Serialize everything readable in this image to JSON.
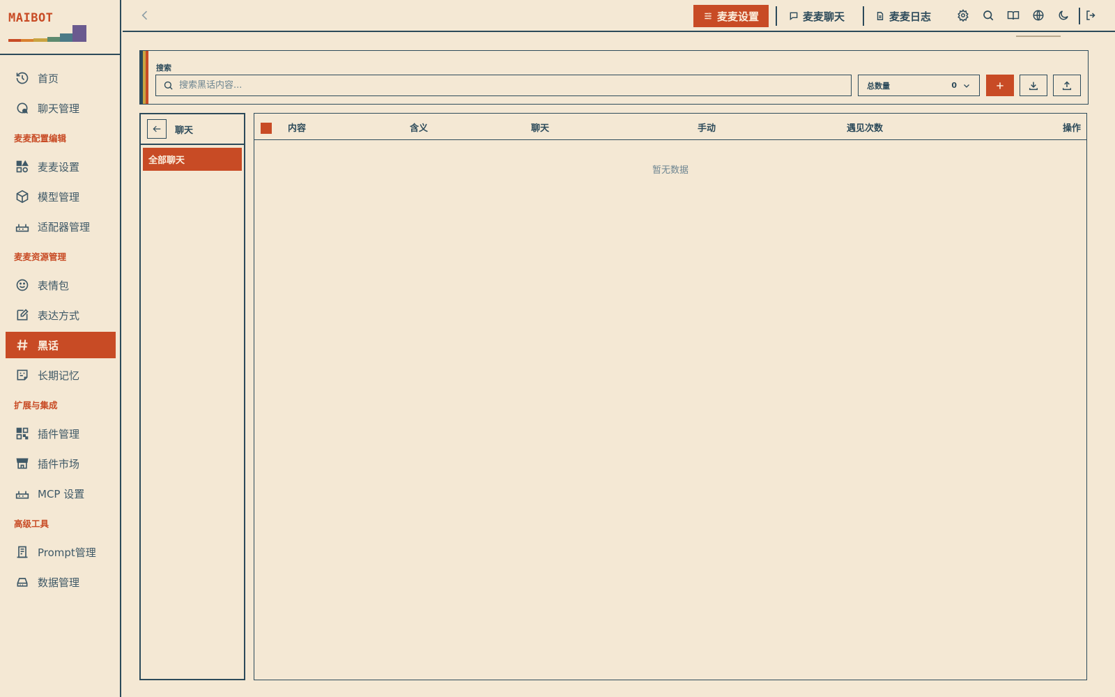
{
  "logo": {
    "text": "MAIBOT"
  },
  "colors": {
    "accent": "#c84b25",
    "ink": "#2c4a5a",
    "background": "#f4e8d4"
  },
  "sidebar": {
    "items": [
      {
        "type": "item",
        "label": "首页",
        "icon": "home-icon"
      },
      {
        "type": "item",
        "label": "聊天管理",
        "icon": "chat-manage-icon"
      },
      {
        "type": "section",
        "label": "麦麦配置编辑"
      },
      {
        "type": "item",
        "label": "麦麦设置",
        "icon": "settings-shapes-icon"
      },
      {
        "type": "item",
        "label": "模型管理",
        "icon": "cube-icon"
      },
      {
        "type": "item",
        "label": "适配器管理",
        "icon": "router-icon"
      },
      {
        "type": "section",
        "label": "麦麦资源管理"
      },
      {
        "type": "item",
        "label": "表情包",
        "icon": "smile-icon"
      },
      {
        "type": "item",
        "label": "表达方式",
        "icon": "edit-note-icon"
      },
      {
        "type": "item",
        "label": "黑话",
        "icon": "hash-icon",
        "active": true
      },
      {
        "type": "item",
        "label": "长期记忆",
        "icon": "memory-icon"
      },
      {
        "type": "section",
        "label": "扩展与集成"
      },
      {
        "type": "item",
        "label": "插件管理",
        "icon": "plugin-grid-icon"
      },
      {
        "type": "item",
        "label": "插件市场",
        "icon": "store-icon"
      },
      {
        "type": "item",
        "label": "MCP 设置",
        "icon": "router-icon"
      },
      {
        "type": "section",
        "label": "高级工具"
      },
      {
        "type": "item",
        "label": "Prompt管理",
        "icon": "prompt-doc-icon"
      },
      {
        "type": "item",
        "label": "数据管理",
        "icon": "drive-icon"
      }
    ]
  },
  "topbar": {
    "settings_label": "麦麦设置",
    "chat_label": "麦麦聊天",
    "log_label": "麦麦日志"
  },
  "search": {
    "label": "搜索",
    "placeholder": "搜索黑话内容...",
    "value": "",
    "count_label": "总数量",
    "count_value": "0"
  },
  "chat_panel": {
    "title": "聊天",
    "all_label": "全部聊天"
  },
  "table": {
    "columns": [
      "内容",
      "含义",
      "聊天",
      "手动",
      "遇见次数",
      "操作"
    ],
    "rows": [],
    "empty_text": "暂无数据"
  }
}
